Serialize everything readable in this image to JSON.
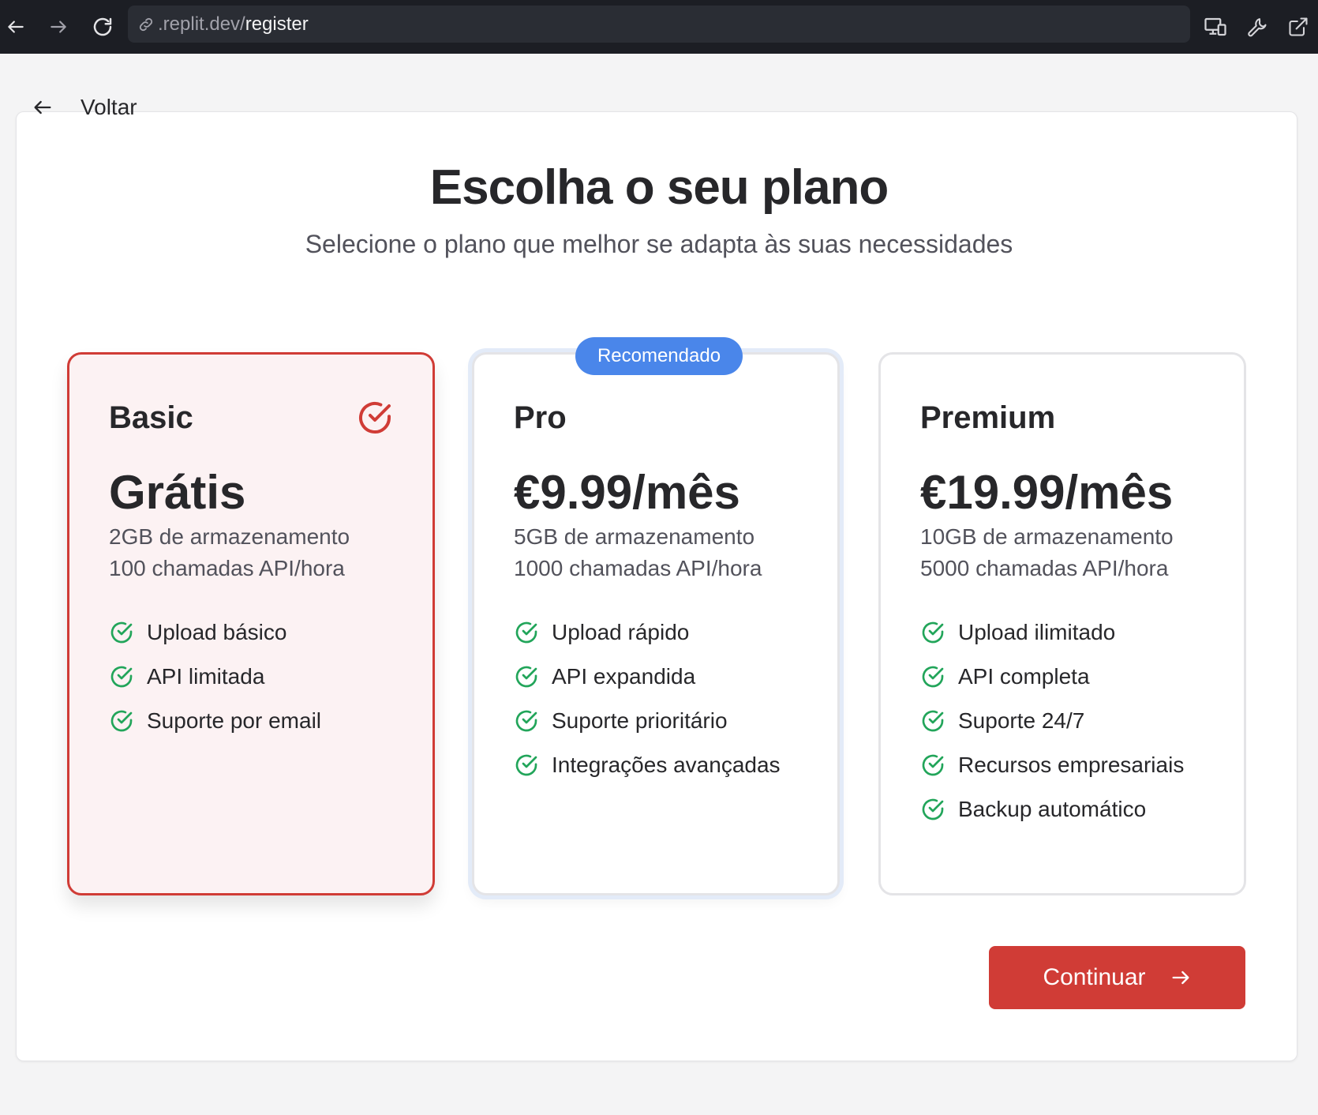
{
  "browser": {
    "url_host": ".replit.dev/",
    "url_path": "register"
  },
  "back": {
    "label": "Voltar"
  },
  "page": {
    "title": "Escolha o seu plano",
    "subtitle": "Selecione o plano que melhor se adapta às suas necessidades"
  },
  "plans": [
    {
      "name": "Basic",
      "price": "Grátis",
      "storage": "2GB de armazenamento",
      "api": "100 chamadas API/hora",
      "selected": true,
      "features": [
        "Upload básico",
        "API limitada",
        "Suporte por email"
      ]
    },
    {
      "name": "Pro",
      "price": "€9.99/mês",
      "storage": "5GB de armazenamento",
      "api": "1000 chamadas API/hora",
      "badge": "Recomendado",
      "features": [
        "Upload rápido",
        "API expandida",
        "Suporte prioritário",
        "Integrações avançadas"
      ]
    },
    {
      "name": "Premium",
      "price": "€19.99/mês",
      "storage": "10GB de armazenamento",
      "api": "5000 chamadas API/hora",
      "features": [
        "Upload ilimitado",
        "API completa",
        "Suporte 24/7",
        "Recursos empresariais",
        "Backup automático"
      ]
    }
  ],
  "continue_button": {
    "label": "Continuar"
  },
  "colors": {
    "accent": "#d03c36",
    "badge": "#4a86ea",
    "check": "#22a55a",
    "topbar": "#1c1e24"
  },
  "icons": {
    "browser_back": "arrow-left-icon",
    "browser_forward": "arrow-right-icon",
    "reload": "reload-icon",
    "url": "link-icon",
    "devices": "devices-icon",
    "tools": "wrench-icon",
    "open_external": "external-link-icon",
    "back": "arrow-left-icon",
    "selected": "check-circle-icon",
    "feature": "check-circle-icon",
    "continue": "arrow-right-icon"
  }
}
